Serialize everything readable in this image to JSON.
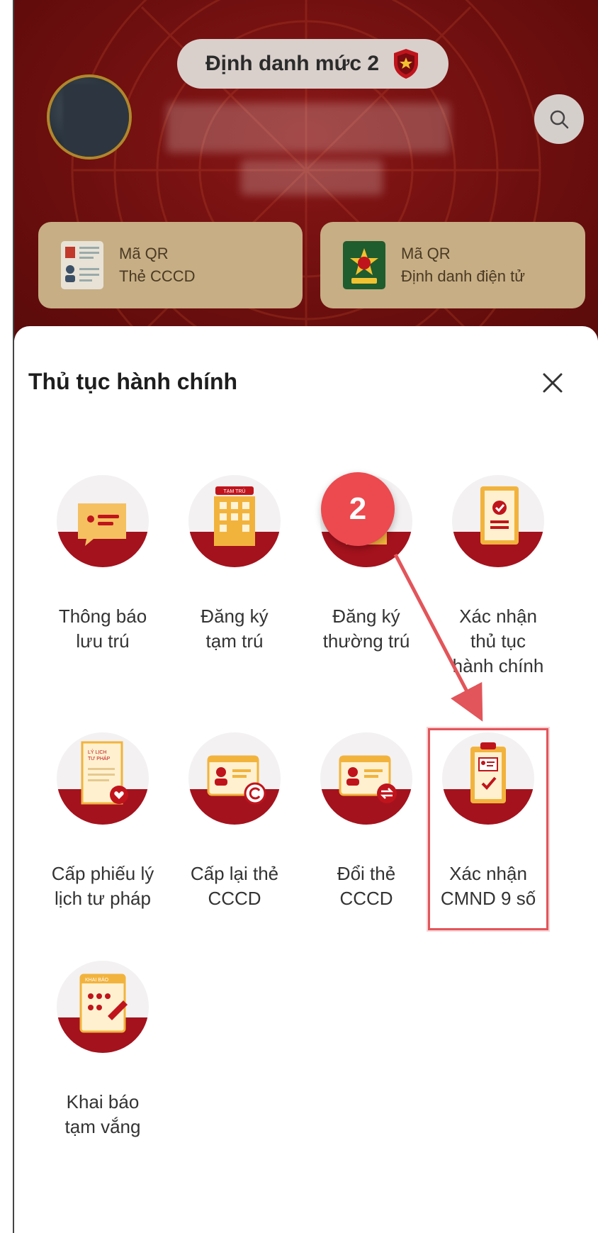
{
  "header": {
    "level_label": "Định danh mức 2",
    "qr_cards": [
      {
        "line1": "Mã QR",
        "line2": "Thẻ CCCD"
      },
      {
        "line1": "Mã QR",
        "line2": "Định danh điện tử"
      }
    ]
  },
  "sheet": {
    "title": "Thủ tục hành chính",
    "tiles": [
      {
        "lines": [
          "Thông báo",
          "lưu trú"
        ]
      },
      {
        "lines": [
          "Đăng ký",
          "tạm trú"
        ],
        "icon_text": "TẠM TRÚ"
      },
      {
        "lines": [
          "Đăng ký",
          "thường trú"
        ]
      },
      {
        "lines": [
          "Xác nhận",
          "thủ tục",
          "hành chính"
        ]
      },
      {
        "lines": [
          "Cấp phiếu lý",
          "lịch tư pháp"
        ],
        "icon_text": [
          "LÝ LỊCH",
          "TƯ PHÁP"
        ]
      },
      {
        "lines": [
          "Cấp lại thẻ",
          "CCCD"
        ]
      },
      {
        "lines": [
          "Đổi thẻ",
          "CCCD"
        ]
      },
      {
        "lines": [
          "Xác nhận",
          "CMND 9 số"
        ]
      },
      {
        "lines": [
          "Khai báo",
          "tạm vắng"
        ],
        "icon_text": "KHAI BÁO"
      }
    ]
  },
  "annotation": {
    "step_number": "2"
  },
  "colors": {
    "header_red": "#6e0f0f",
    "accent_red": "#a4121d",
    "gold": "#f2b33d",
    "badge_red": "#ec4a4f"
  }
}
